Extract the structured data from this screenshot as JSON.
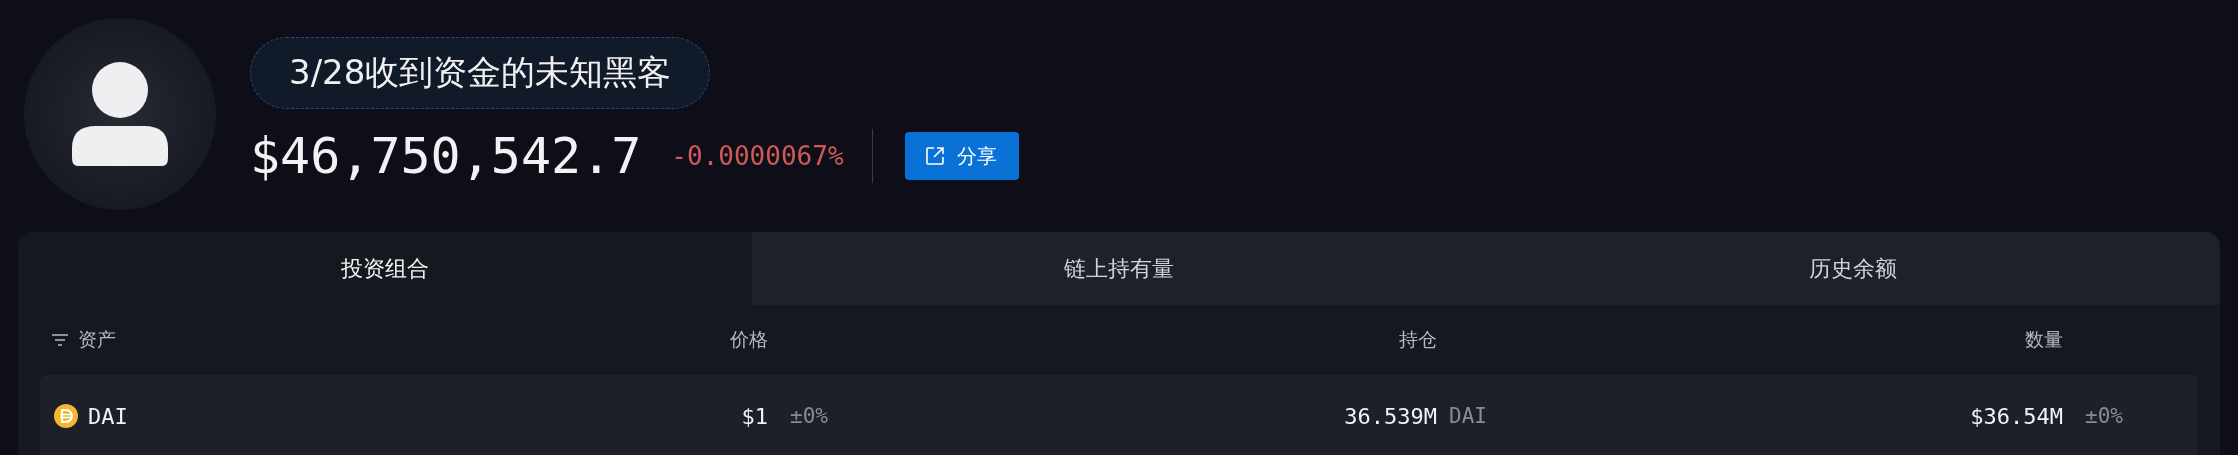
{
  "profile": {
    "tag": "3/28收到资金的未知黑客",
    "value": "$46,750,542.7",
    "change": "-0.0000067%",
    "negative": true,
    "share_button": "分享"
  },
  "tabs": [
    {
      "label": "投资组合",
      "selected": true
    },
    {
      "label": "链上持有量",
      "selected": false
    },
    {
      "label": "历史余额",
      "selected": false
    }
  ],
  "table": {
    "columns": [
      "资产",
      "价格",
      "持仓",
      "数量"
    ],
    "rows": [
      {
        "asset": "DAI",
        "price": "$1",
        "price_change": "±0%",
        "price_negative": false,
        "holding": "36.539M",
        "holding_unit": "DAI",
        "amount": "$36.54M",
        "amount_change": "±0%",
        "amount_negative": false
      }
    ]
  }
}
